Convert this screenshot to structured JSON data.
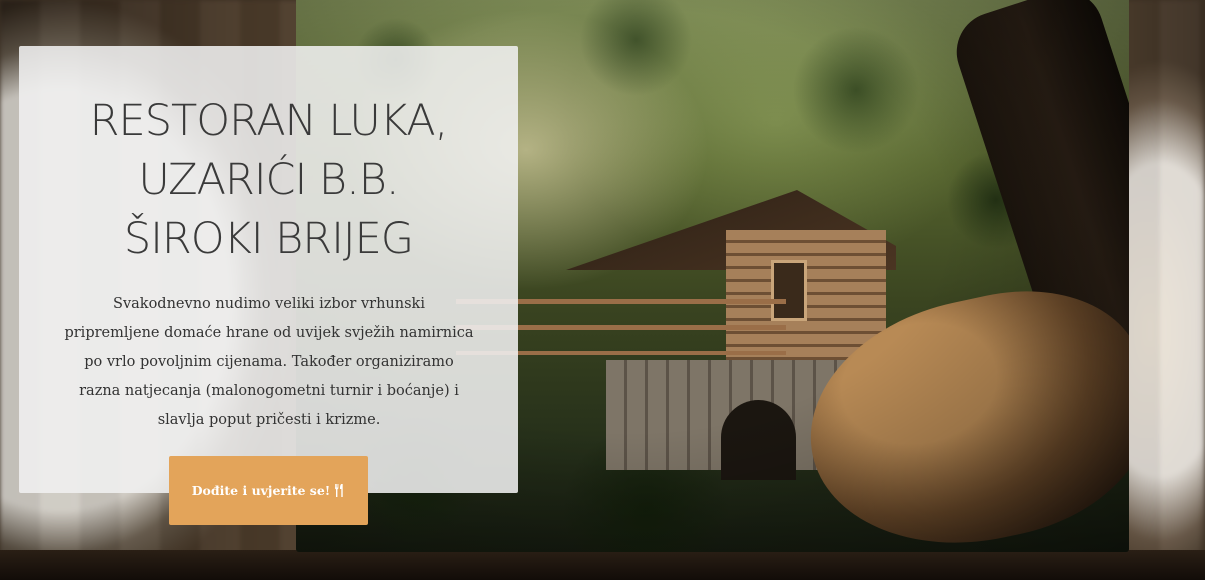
{
  "hero": {
    "title_lines": [
      "RESTORAN LUKA,",
      "UZARIĆI B.B.",
      "ŠIROKI BRIJEG"
    ],
    "description": "Svakodnevno nudimo veliki izbor vrhunski pripremljene domaće hrane od uvijek svježih namirnica po vrlo povoljnim cijenama. Također organiziramo razna natjecanja (malonogometni turnir i boćanje) i slavlja poput pričesti i krizme.",
    "cta_label": "Dođite i uvjerite se!",
    "cta_icon": "utensils-icon",
    "accent_color": "#e3a45a"
  }
}
